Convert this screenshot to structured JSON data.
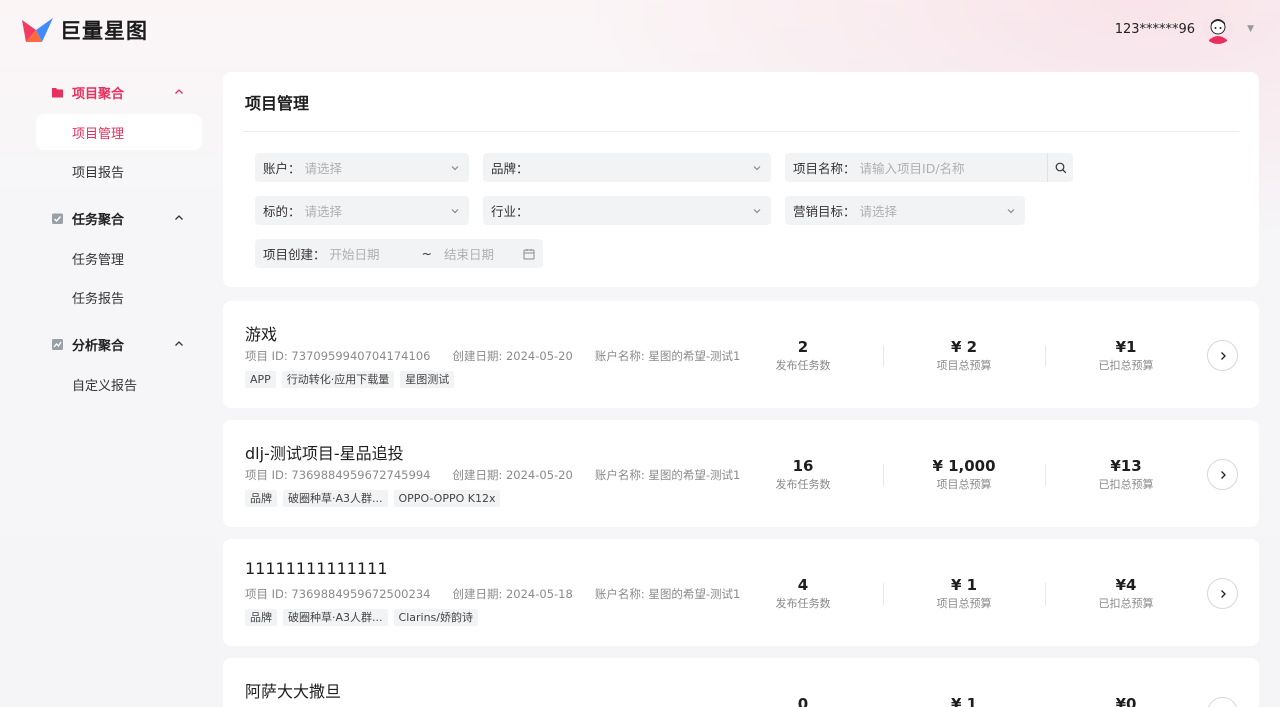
{
  "header": {
    "logo_text": "巨量星图",
    "user_name": "123******96"
  },
  "sidebar": {
    "groups": [
      {
        "label": "项目聚合",
        "items": [
          "项目管理",
          "项目报告"
        ]
      },
      {
        "label": "任务聚合",
        "items": [
          "任务管理",
          "任务报告"
        ]
      },
      {
        "label": "分析聚合",
        "items": [
          "自定义报告"
        ]
      }
    ]
  },
  "filters": {
    "page_title": "项目管理",
    "account": {
      "label": "账户：",
      "value": "请选择"
    },
    "brand": {
      "label": "品牌：",
      "value": ""
    },
    "project_name": {
      "label": "项目名称：",
      "placeholder": "请输入项目ID/名称"
    },
    "target": {
      "label": "标的：",
      "value": "请选择"
    },
    "industry": {
      "label": "行业：",
      "value": ""
    },
    "goal": {
      "label": "营销目标：",
      "value": "请选择"
    },
    "created": {
      "label": "项目创建：",
      "start": "开始日期",
      "sep": "~",
      "end": "结束日期"
    }
  },
  "projects": [
    {
      "title": "游戏",
      "id": "项目 ID: 7370959940704174106",
      "date": "创建日期: 2024-05-20",
      "account": "账户名称: 星图的希望-测试1",
      "tags": [
        "APP",
        "行动转化·应用下载量",
        "星图测试"
      ],
      "tasks": "2",
      "tasks_label": "发布任务数",
      "budget": "¥ 2",
      "budget_label": "项目总预算",
      "deducted": "¥1",
      "deducted_label": "已扣总预算"
    },
    {
      "title": "dlj-测试项目-星品追投",
      "id": "项目 ID: 7369884959672745994",
      "date": "创建日期: 2024-05-20",
      "account": "账户名称: 星图的希望-测试1",
      "tags": [
        "品牌",
        "破圈种草·A3人群...",
        "OPPO-OPPO K12x"
      ],
      "tasks": "16",
      "tasks_label": "发布任务数",
      "budget": "¥ 1,000",
      "budget_label": "项目总预算",
      "deducted": "¥13",
      "deducted_label": "已扣总预算"
    },
    {
      "title": "11111111111111",
      "id": "项目 ID: 7369884959672500234",
      "date": "创建日期: 2024-05-18",
      "account": "账户名称: 星图的希望-测试1",
      "tags": [
        "品牌",
        "破圈种草·A3人群...",
        "Clarins/娇韵诗"
      ],
      "tasks": "4",
      "tasks_label": "发布任务数",
      "budget": "¥ 1",
      "budget_label": "项目总预算",
      "deducted": "¥4",
      "deducted_label": "已扣总预算"
    },
    {
      "title": "阿萨大大撒旦",
      "id": "",
      "date": "",
      "account": "",
      "tags": [],
      "tasks": "0",
      "tasks_label": "",
      "budget": "¥ 1",
      "budget_label": "",
      "deducted": "¥0",
      "deducted_label": ""
    }
  ]
}
